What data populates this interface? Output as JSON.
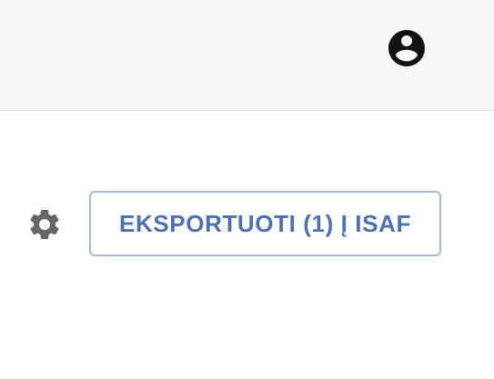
{
  "header": {
    "account_icon": "account-circle-icon"
  },
  "toolbar": {
    "settings_icon": "gear-icon",
    "export_label": "EKSPORTUOTI (1) Į ISAF"
  },
  "colors": {
    "topbar_bg": "#f8f8f8",
    "button_text": "#4d70b0",
    "button_border": "#a6b9d4",
    "icon_dark": "#111111",
    "icon_gray": "#666666"
  }
}
